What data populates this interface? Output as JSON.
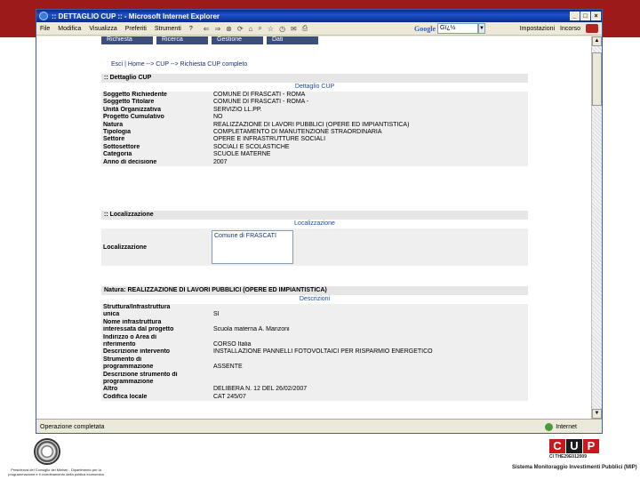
{
  "window": {
    "title": ":: DETTAGLIO CUP :: - Microsoft Internet Explorer"
  },
  "menu": {
    "items": [
      "File",
      "Modifica",
      "Visualizza",
      "Preferiti",
      "Strumenti",
      "?"
    ],
    "search_placeholder": "Gï¿½",
    "search_brand": "Google",
    "right_items": [
      "Impostazioni",
      "Incorso"
    ]
  },
  "tabs": [
    "Richiesta",
    "Ricerca",
    "Gestione",
    "Dati"
  ],
  "breadcrumb": "Esci  |     Home --> CUP --> Richiesta CUP completo",
  "dettaglio": {
    "header": ":: Dettaglio CUP",
    "subheader": "Dettaglio CUP",
    "rows": [
      {
        "k": "Soggetto Richiedente",
        "v": "COMUNE DI FRASCATI - ROMA"
      },
      {
        "k": "Soggetto Titolare",
        "v": "COMUNE DI FRASCATI - ROMA -"
      },
      {
        "k": "Unità Organizzativa",
        "v": "SERVIZIO LL.PP."
      },
      {
        "k": "Progetto Cumulativo",
        "v": "NO"
      },
      {
        "k": "Natura",
        "v": "REALIZZAZIONE DI LAVORI PUBBLICI (OPERE ED IMPIANTISTICA)"
      },
      {
        "k": "Tipologia",
        "v": "COMPLETAMENTO DI MANUTENZIONE STRAORDINARIA"
      },
      {
        "k": "Settore",
        "v": "OPERE E INFRASTRUTTURE SOCIALI"
      },
      {
        "k": "Sottosettore",
        "v": "SOCIALI E SCOLASTICHE"
      },
      {
        "k": "Categoria",
        "v": "SCUOLE MATERNE"
      },
      {
        "k": "Anno di decisione",
        "v": "2007"
      }
    ]
  },
  "localizzazione": {
    "header": ":: Localizzazione",
    "subheader": "Localizzazione",
    "label": "Localizzazione",
    "items": [
      "Comune di FRASCATI"
    ]
  },
  "natura": {
    "header": "Natura: REALIZZAZIONE DI LAVORI PUBBLICI (OPERE ED IMPIANTISTICA)",
    "subheader": "Descrizioni",
    "rows": [
      {
        "k": "Struttura/Infrastruttura",
        "v": ""
      },
      {
        "k": "unica",
        "v": "SI"
      },
      {
        "k": "Nome infrastruttura",
        "v": ""
      },
      {
        "k": "interessata dal progetto",
        "v": "Scuola materna A. Manzoni"
      },
      {
        "k": "Indirizzo o Area di",
        "v": ""
      },
      {
        "k": "riferimento",
        "v": "CORSO Italia"
      },
      {
        "k": "Descrizione intervento",
        "v": "INSTALLAZIONE PANNELLI FOTOVOLTAICI PER RISPARMIO ENERGETICO"
      },
      {
        "k": "Strumento di",
        "v": ""
      },
      {
        "k": "programmazione",
        "v": "ASSENTE"
      },
      {
        "k": "Descrizione strumento di",
        "v": ""
      },
      {
        "k": "programmazione",
        "v": ""
      },
      {
        "k": "Altro",
        "v": "DELIBERA N. 12 DEL 26/02/2007"
      },
      {
        "k": "Codifica locale",
        "v": "CAT 245/07"
      }
    ]
  },
  "status": {
    "text": "Operazione completata",
    "zone": "Internet"
  },
  "footer": {
    "left_text": "Presidenza del Consiglio dei Ministri - Dipartimento per la programmazione e il coordinamento della politica economica",
    "logo_letters": [
      "C",
      "U",
      "P"
    ],
    "code": "CI THE29E012009",
    "system": "Sistema Monitoraggio Investimenti Pubblici (MIP)"
  }
}
